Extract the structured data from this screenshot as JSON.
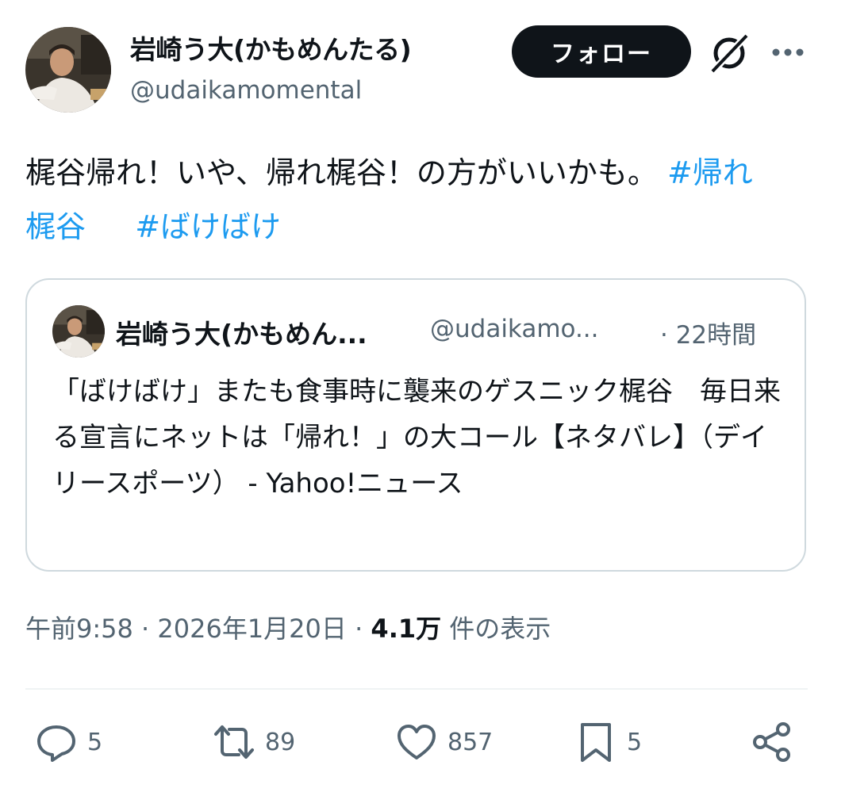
{
  "author": {
    "display_name": "岩崎う大(かもめんたる)",
    "handle": "@udaikamomental",
    "avatar": "avatar-photo"
  },
  "header": {
    "follow_label": "フォロー",
    "grok_icon": "grok-icon",
    "more_icon": "more-icon"
  },
  "tweet": {
    "text": "梶谷帰れ！いや、帰れ梶谷！の方がいいかも。",
    "hashtags": [
      "#帰れ梶谷",
      "#ばけばけ"
    ],
    "hashtag_color": "#1d9bf0"
  },
  "quote": {
    "display_name": "岩崎う大(かもめん...",
    "handle": "@udaikamo...",
    "time": "· 22時間",
    "text": "「ばけばけ」またも食事時に襲来のゲスニック梶谷　毎日来る宣言にネットは「帰れ！」の大コール【ネタバレ】（デイリースポーツ） - Yahoo!ニュース"
  },
  "meta": {
    "time": "午前9:58 · 2026年1月20日 · ",
    "views_count": "4.1万",
    "views_label": " 件の表示"
  },
  "actions": {
    "reply": {
      "icon": "reply-icon",
      "count": "5"
    },
    "retweet": {
      "icon": "retweet-icon",
      "count": "89"
    },
    "like": {
      "icon": "heart-icon",
      "count": "857"
    },
    "bookmark": {
      "icon": "bookmark-icon",
      "count": "5"
    },
    "share": {
      "icon": "share-icon"
    }
  }
}
